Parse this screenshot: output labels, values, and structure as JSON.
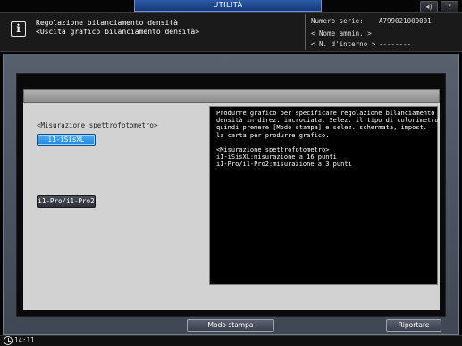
{
  "top_tab": {
    "label": "UTILITÀ"
  },
  "top_buttons": {
    "volume_icon": "speaker-icon",
    "help_label": "?"
  },
  "header": {
    "title_line1": "Regolazione bilanciamento densità",
    "title_line2": "<Uscita grafico bilanciamento densità>",
    "serial_label": "Numero serie:",
    "serial_value": "A799021000001",
    "admin_label": "< Nome ammin. >",
    "internal_label": "< N. d'interno >",
    "internal_value": "--------"
  },
  "left": {
    "section_label": "<Misurazione spettrofotometro>",
    "option_1": "i1-iSisXL",
    "option_2": "i1-Pro/i1-Pro2"
  },
  "description": {
    "lines": [
      "Produrre grafico per specificare regolazione bilanciamento",
      "densità in direz. incrociata. Selez. il tipo di colorimetro",
      "quindi premere [Modo stampa] e selez. schermata, impost.",
      "la carta per produrre grafico.",
      "",
      "<Misurazione spettrofotometro>",
      "i1-iSisXL:misurazione a 16 punti",
      "i1-Pro/i1-Pro2:misurazione a 3 punti"
    ]
  },
  "bottom": {
    "print_mode_label": "Modo stampa",
    "back_label": "Riportare"
  },
  "status": {
    "clock": "14:11",
    "clock_icon": "clock-icon"
  },
  "colors": {
    "accent_blue": "#1f82d8",
    "tab_blue": "#2c5aa8",
    "panel_gray": "#d2d2d2"
  }
}
